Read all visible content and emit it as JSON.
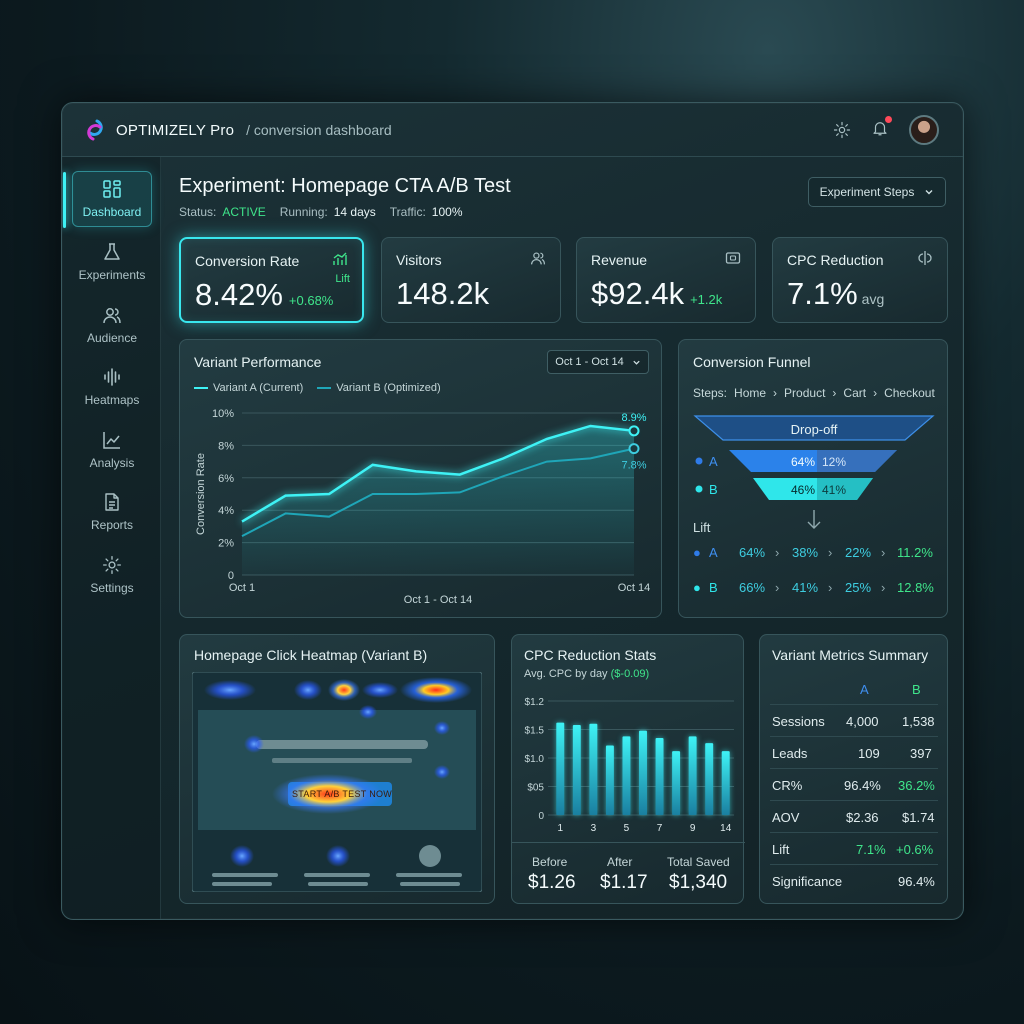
{
  "app": {
    "brand": "OPTIMIZELY Pro",
    "breadcrumb": "/ conversion dashboard"
  },
  "sidebar": {
    "items": [
      {
        "label": "Dashboard",
        "icon": "dashboard-grid-icon",
        "active": true
      },
      {
        "label": "Experiments",
        "icon": "flask-icon"
      },
      {
        "label": "Audience",
        "icon": "users-icon"
      },
      {
        "label": "Heatmaps",
        "icon": "waveform-icon"
      },
      {
        "label": "Analysis",
        "icon": "line-chart-icon"
      },
      {
        "label": "Reports",
        "icon": "document-icon"
      },
      {
        "label": "Settings",
        "icon": "gear-icon"
      }
    ]
  },
  "experiment": {
    "title": "Experiment: Homepage CTA A/B Test",
    "status_label": "Status:",
    "status": "ACTIVE",
    "running_label": "Running:",
    "running": "14 days",
    "traffic_label": "Traffic:",
    "traffic": "100%",
    "steps_button": "Experiment Steps"
  },
  "kpis": [
    {
      "label": "Conversion Rate",
      "value": "8.42%",
      "delta": "+0.68%",
      "tag": "Lift"
    },
    {
      "label": "Visitors",
      "value": "148.2k"
    },
    {
      "label": "Revenue",
      "value": "$92.4k",
      "delta": "+1.2k"
    },
    {
      "label": "CPC Reduction",
      "value": "7.1%",
      "suffix": "avg"
    }
  ],
  "variant_performance": {
    "title": "Variant Performance",
    "date_range": "Oct 1 - Oct 14",
    "legend_a": "Variant A (Current)",
    "legend_b": "Variant B (Optimized)",
    "end_label_a": "8.9%",
    "end_label_b": "7.8%"
  },
  "chart_data": [
    {
      "type": "line",
      "ylabel": "Conversion Rate",
      "xlabel": "Oct 1 - Oct 14",
      "x_ticks": [
        "Oct 1",
        "Oct 14"
      ],
      "y_ticks": [
        "0",
        "2%",
        "4%",
        "6%",
        "8%",
        "10%"
      ],
      "ylim": [
        0,
        10
      ],
      "grid": true,
      "series": [
        {
          "name": "Variant A (Current)",
          "color": "#3ef2f5",
          "values": [
            3.3,
            4.9,
            5.0,
            6.8,
            6.4,
            6.2,
            7.2,
            8.4,
            9.2,
            8.9
          ]
        },
        {
          "name": "Variant B (Optimized)",
          "color": "#1fa6b8",
          "values": [
            2.4,
            3.8,
            3.6,
            5.0,
            5.0,
            5.1,
            6.1,
            7.0,
            7.2,
            7.8
          ]
        }
      ]
    },
    {
      "type": "bar",
      "title": "CPC Reduction Stats",
      "subtitle": "Avg. CPC by day",
      "subtitle_delta": "($-0.09)",
      "y_ticks": [
        "0",
        "$05",
        "$1.0",
        "$1.5",
        "$1.2"
      ],
      "x_ticks": [
        "1",
        "3",
        "5",
        "7",
        "9",
        "14"
      ],
      "ylim": [
        0,
        2
      ],
      "values": [
        1.62,
        1.58,
        1.6,
        1.22,
        1.38,
        1.48,
        1.35,
        1.12,
        1.38,
        1.26,
        1.12
      ]
    }
  ],
  "funnel": {
    "title": "Conversion Funnel",
    "steps_label": "Steps:",
    "steps": [
      "Home",
      "Product",
      "Cart",
      "Checkout"
    ],
    "dropoff": "Drop-off",
    "a_label": "A",
    "a_pct": "64%",
    "a_drop": "12%",
    "b_label": "B",
    "b_pct": "46%",
    "b_drop": "41%",
    "lift_label": "Lift",
    "lift_a": [
      "64%",
      "38%",
      "22%",
      "11.2%"
    ],
    "lift_b": [
      "66%",
      "41%",
      "25%",
      "12.8%"
    ]
  },
  "heatmap": {
    "title": "Homepage Click Heatmap (Variant B)",
    "cta": "START A/B TEST NOW"
  },
  "cpc": {
    "before_label": "Before",
    "before": "$1.26",
    "after_label": "After",
    "after": "$1.17",
    "saved_label": "Total Saved",
    "saved": "$1,340"
  },
  "summary": {
    "title": "Variant Metrics Summary",
    "col_a": "A",
    "col_b": "B",
    "rows": [
      {
        "label": "Sessions",
        "a": "4,000",
        "b": "1,538"
      },
      {
        "label": "Leads",
        "a": "109",
        "b": "397"
      },
      {
        "label": "CR%",
        "a": "96.4%",
        "b": "36.2%"
      },
      {
        "label": "AOV",
        "a": "$2.36",
        "b": "$1.74"
      },
      {
        "label": "Lift",
        "a": "7.1%",
        "b": "+0.6%"
      },
      {
        "label": "Significance",
        "a": "",
        "b": "96.4%"
      }
    ]
  },
  "colors": {
    "accent": "#3ef2f5",
    "positive": "#3fe58b",
    "variant_a": "#2f7be8",
    "variant_b": "#2fe6ea"
  }
}
